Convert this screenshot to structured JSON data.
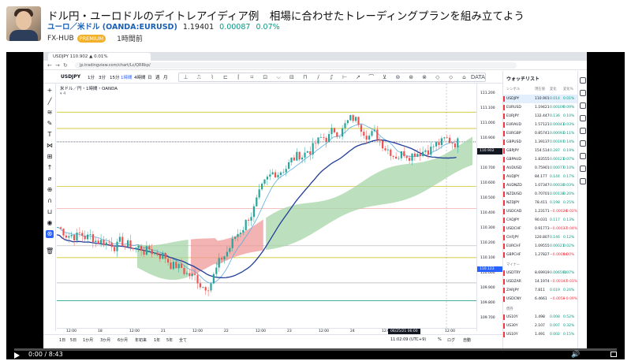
{
  "header": {
    "title": "ドル円・ユーロドルのデイトレアイディア例　相場に合わせたトレーディングプランを組み立てよう",
    "symbol": "ユーロ／米ドル (OANDA:EURUSD)",
    "price": "1.19401",
    "change": "0.00087",
    "change_pct": "0.07%",
    "channel": "FX-HUB",
    "badge": "PREMIUM",
    "duration": "1時間前"
  },
  "browser": {
    "tab_title": "USDJPY 110.902 ▲ 0.01%",
    "url": "jp.tradingview.com/chart/Lc/QRRkp/"
  },
  "tv": {
    "symbol": "USDJPY",
    "timeframes": [
      "1分",
      "3分",
      "15分",
      "1時間",
      "4時間",
      "日",
      "週",
      "月"
    ],
    "legend": "米ドル／円・1時間・OANDA",
    "legend2": "▾ 4"
  },
  "draw_tools": [
    "⊥",
    "⎍",
    "⌇",
    "⊏",
    "⌈",
    "⌑",
    "⊡",
    "⌵",
    "⊟",
    "⊓",
    "∕",
    "⎎",
    "⊢",
    "↗",
    "⌒",
    "⊻",
    "⊚",
    "⊛",
    "⊗",
    "◇",
    "⬦",
    "⌂",
    "DATA"
  ],
  "price_axis": {
    "ticks": [
      "111.200",
      "111.100",
      "111.000",
      "110.900",
      "110.800",
      "110.700",
      "110.600",
      "110.500",
      "110.400",
      "110.300",
      "110.200",
      "110.100",
      "110.000",
      "109.900",
      "109.800",
      "109.700"
    ],
    "current_label": "110.902",
    "cursor_label": "110.123"
  },
  "time_axis": {
    "ticks": [
      "12:00",
      "18",
      "12:00",
      "21",
      "12:00",
      "22",
      "12:00",
      "23",
      "12:00",
      "24",
      "12:00",
      "28",
      "12:00"
    ],
    "cursor": "06/25/21 06:00"
  },
  "bottom_bar": [
    "1日",
    "5日",
    "1か月",
    "3か月",
    "6か月",
    "年初来",
    "1年",
    "5年",
    "全て",
    "11:02:09 (UTC+9)",
    "%",
    "ログ",
    "自動"
  ],
  "watchlist": {
    "title": "ウォッチリスト",
    "columns": [
      "シンボル",
      "現在値",
      "変化",
      "変化%"
    ],
    "rows": [
      {
        "s": "USDJPY",
        "p": "110.901",
        "c": "0.014",
        "r": "0.01%",
        "up": true
      },
      {
        "s": "EURUSD",
        "p": "1.19421",
        "c": "0.00109",
        "r": "0.09%",
        "up": true
      },
      {
        "s": "EURJPY",
        "p": "132.447",
        "c": "0.136",
        "r": "0.10%",
        "up": true
      },
      {
        "s": "EURAUD",
        "p": "1.57121",
        "c": "0.00041",
        "r": "0.03%",
        "up": true
      },
      {
        "s": "EURGBP",
        "p": "0.85741",
        "c": "0.00093",
        "r": "0.11%",
        "up": true
      },
      {
        "s": "GBPUSD",
        "p": "1.39137",
        "c": "0.00197",
        "r": "0.14%",
        "up": true
      },
      {
        "s": "GBPJPY",
        "p": "154.514",
        "c": "0.287",
        "r": "0.19%",
        "up": true
      },
      {
        "s": "GBPAUD",
        "p": "1.83555",
        "c": "0.00121",
        "r": "0.07%",
        "up": true
      },
      {
        "s": "AUDUSD",
        "p": "0.75901",
        "c": "0.00077",
        "r": "0.10%",
        "up": true
      },
      {
        "s": "AUDJPY",
        "p": "84.177",
        "c": "0.144",
        "r": "0.17%",
        "up": true
      },
      {
        "s": "AUDNZD",
        "p": "1.07347",
        "c": "0.00030",
        "r": "0.03%",
        "up": true
      },
      {
        "s": "NZDUSD",
        "p": "0.70701",
        "c": "0.00138",
        "r": "0.20%",
        "up": true
      },
      {
        "s": "NZDJPY",
        "p": "78.411",
        "c": "0.198",
        "r": "0.25%",
        "up": true
      },
      {
        "s": "USDCAD",
        "p": "1.23171",
        "c": "−0.00026",
        "r": "−0.02%",
        "up": false
      },
      {
        "s": "CADJPY",
        "p": "90.031",
        "c": "0.117",
        "r": "0.13%",
        "up": true
      },
      {
        "s": "USDCHF",
        "p": "0.91773",
        "c": "−0.00037",
        "r": "−0.04%",
        "up": false
      },
      {
        "s": "CHFJPY",
        "p": "120.807",
        "c": "0.146",
        "r": "0.12%",
        "up": true
      },
      {
        "s": "EURCHF",
        "p": "1.09555",
        "c": "0.00021",
        "r": "0.02%",
        "up": true
      },
      {
        "s": "GBPCHF",
        "p": "1.27827",
        "c": "−0.00094",
        "r": "0.00%",
        "up": false
      }
    ],
    "section_minor": "マイナー",
    "minor_rows": [
      {
        "s": "USDTRY",
        "p": "8.69919",
        "c": "0.006590",
        "r": "0.07%",
        "up": true
      },
      {
        "s": "USDZAR",
        "p": "14.1974",
        "c": "−0.00147",
        "r": "−0.01%",
        "up": false
      },
      {
        "s": "ZARJPY",
        "p": "7.811",
        "c": "0.019",
        "r": "0.24%",
        "up": true
      },
      {
        "s": "USDCNY",
        "p": "6.4661",
        "c": "−0.0058",
        "r": "−0.09%",
        "up": false
      }
    ],
    "section_bond": "債券",
    "bond_rows": [
      {
        "s": "US10Y",
        "p": "1.498",
        "c": "0.008",
        "r": "0.52%",
        "up": true
      },
      {
        "s": "US30Y",
        "p": "2.107",
        "c": "0.007",
        "r": "0.32%",
        "up": true
      },
      {
        "s": "US10Y",
        "p": "1.491",
        "c": "0.002",
        "r": "0.15%",
        "up": true
      },
      {
        "s": "US5Y",
        "p": "0.901",
        "c": "0.005",
        "r": "0.57%",
        "up": true
      }
    ]
  },
  "player": {
    "time": "0:00 / 8:43",
    "progress": 0.0
  },
  "colors": {
    "up": "#089981",
    "down": "#f23645",
    "cloud_bull": "#a5d6a7",
    "cloud_bear": "#ef9a9a",
    "accent": "#2962ff"
  }
}
